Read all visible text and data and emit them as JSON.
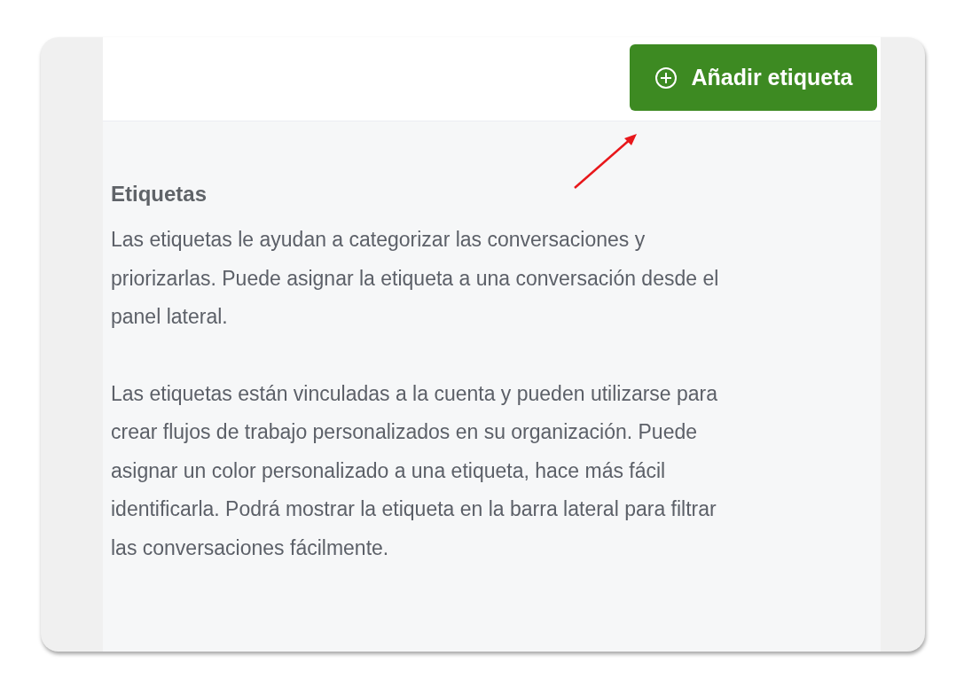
{
  "toolbar": {
    "button": {
      "label": "Añadir etiqueta"
    }
  },
  "info": {
    "title": "Etiquetas",
    "paragraphs": [
      "Las etiquetas le ayudan a categorizar las conversaciones y priorizarlas. Puede asignar la etiqueta a una conversación desde el panel lateral.",
      "Las etiquetas están vinculadas a la cuenta y pueden utilizarse para crear flujos de trabajo personalizados en su organización. Puede asignar un color personalizado a una etiqueta, hace más fácil identificarla. Podrá mostrar la etiqueta en la barra lateral para filtrar las conversaciones fácilmente."
    ]
  }
}
